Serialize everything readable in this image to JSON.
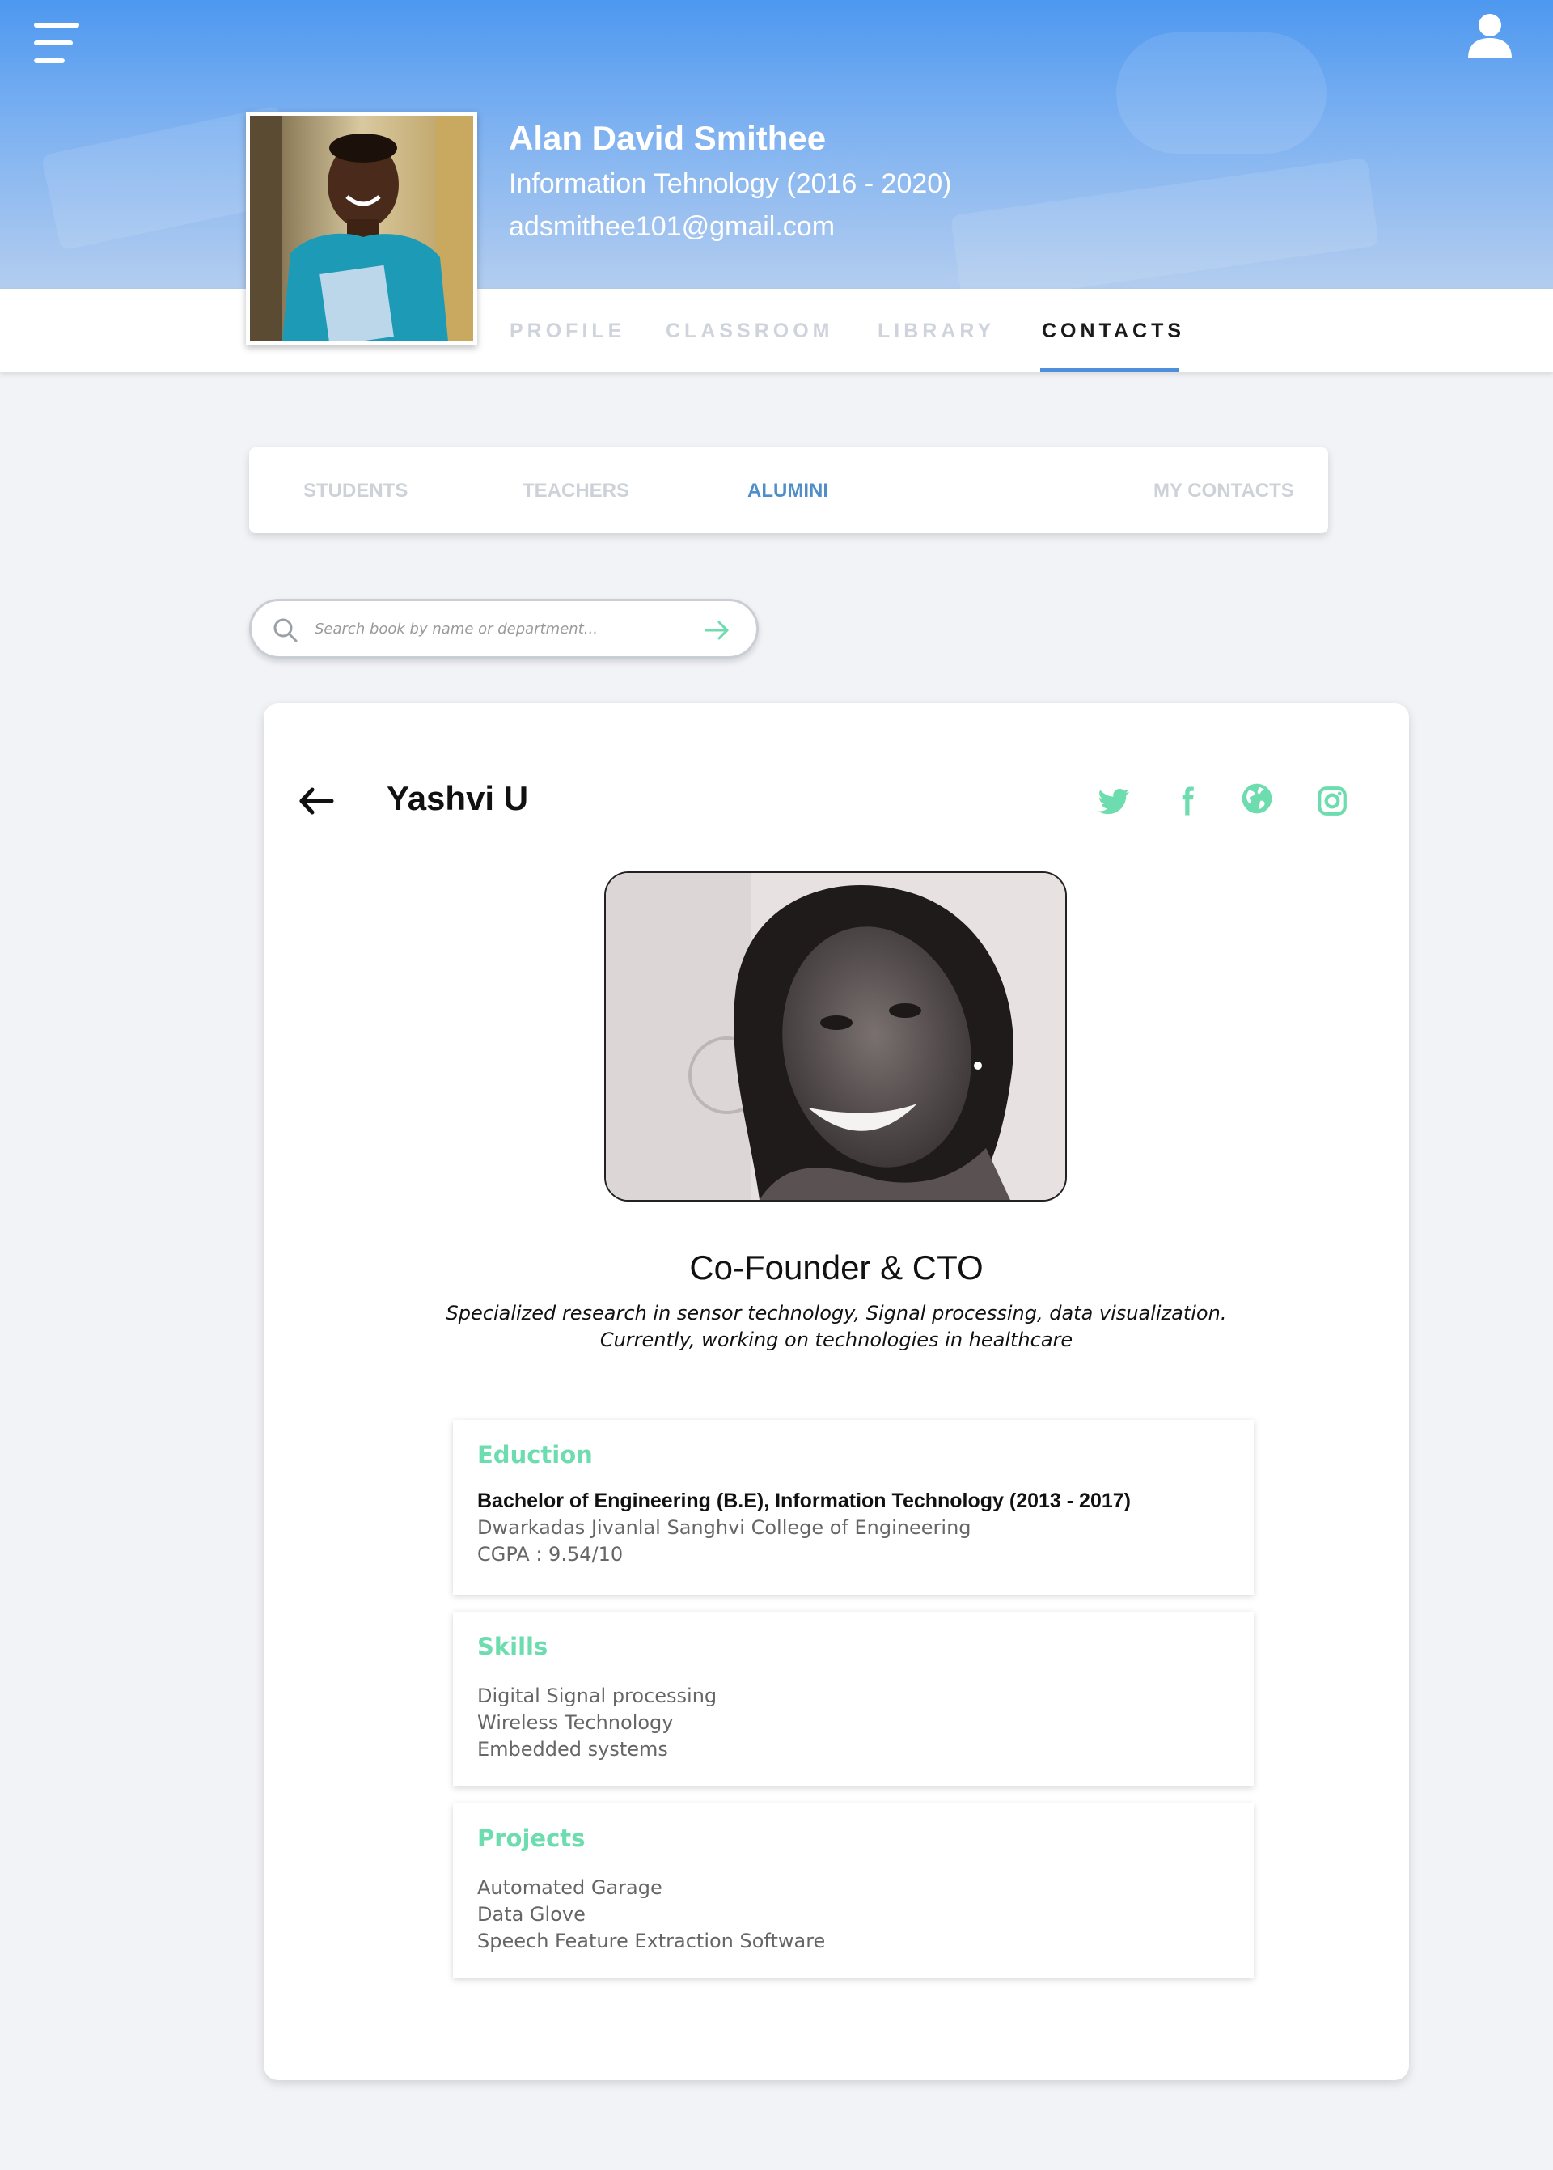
{
  "header": {
    "name": "Alan David Smithee",
    "department": "Information Tehnology (2016 - 2020)",
    "email": "adsmithee101@gmail.com",
    "menu_icon": "hamburger-menu-icon",
    "user_icon": "user-icon"
  },
  "nav": {
    "tabs": [
      "PROFILE",
      "CLASSROOM",
      "LIBRARY",
      "CONTACTS"
    ],
    "active": "CONTACTS"
  },
  "subtabs": {
    "items": [
      "STUDENTS",
      "TEACHERS",
      "ALUMINI",
      "MY CONTACTS"
    ],
    "active": "ALUMINI"
  },
  "search": {
    "placeholder": "Search book by name or department..."
  },
  "contact": {
    "name": "Yashvi U",
    "role": "Co-Founder & CTO",
    "bio_line1": "Specialized research in sensor technology, Signal processing, data visualization.",
    "bio_line2": "Currently, working on technologies in healthcare",
    "social_icons": [
      "twitter-icon",
      "facebook-icon",
      "globe-icon",
      "instagram-icon"
    ],
    "sections": {
      "education": {
        "title": "Eduction",
        "degree": "Bachelor of Engineering (B.E), Information Technology (2013 - 2017)",
        "college": "Dwarkadas Jivanlal Sanghvi College of Engineering",
        "cgpa": "CGPA : 9.54/10"
      },
      "skills": {
        "title": "Skills",
        "items": [
          "Digital Signal processing",
          "Wireless Technology",
          "Embedded systems"
        ]
      },
      "projects": {
        "title": "Projects",
        "items": [
          "Automated Garage",
          "Data Glove",
          "Speech Feature Extraction Software"
        ]
      }
    }
  },
  "colors": {
    "accent_teal": "#6ddcae",
    "active_blue": "#4f8ec9",
    "header_blue": "#4d98f0"
  }
}
